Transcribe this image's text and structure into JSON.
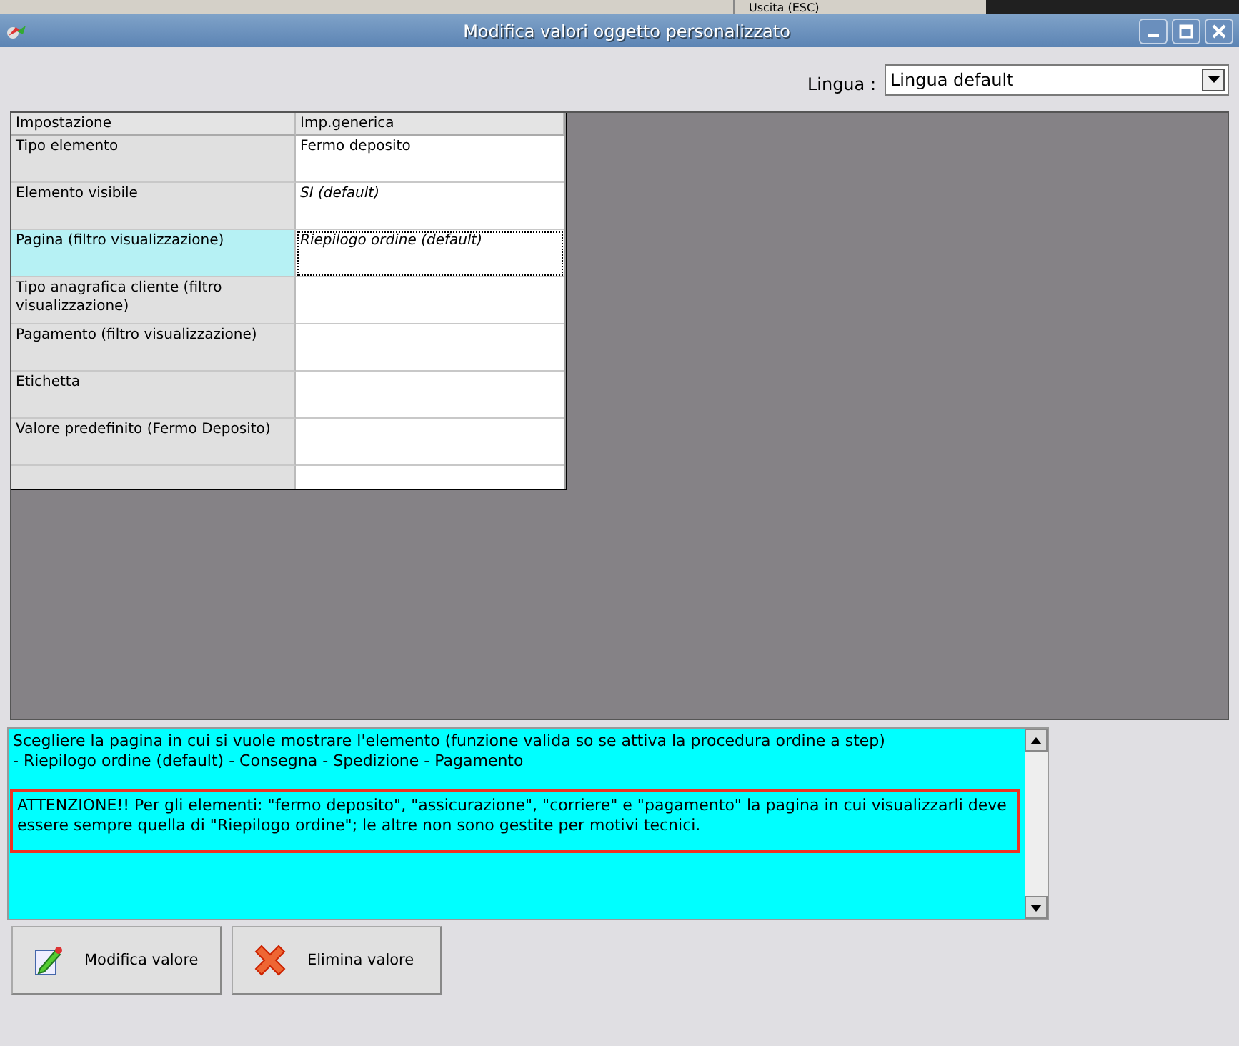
{
  "background_window": {
    "menu_item": "Uscita (ESC)"
  },
  "window": {
    "title": "Modifica valori oggetto personalizzato"
  },
  "language": {
    "label": "Lingua :",
    "value": "Lingua default"
  },
  "table": {
    "columns": [
      "Impostazione",
      "Imp.generica"
    ],
    "rows": [
      {
        "label": "Tipo elemento",
        "value": "Fermo deposito",
        "is_default": false,
        "selected": false
      },
      {
        "label": "Elemento visibile",
        "value": "SI (default)",
        "is_default": true,
        "selected": false
      },
      {
        "label": "Pagina (filtro visualizzazione)",
        "value": "Riepilogo ordine (default)",
        "is_default": true,
        "selected": true
      },
      {
        "label": "Tipo anagrafica cliente (filtro visualizzazione)",
        "selected": false
      },
      {
        "label": "Pagamento (filtro visualizzazione)",
        "selected": false
      },
      {
        "label": "Etichetta",
        "selected": false
      },
      {
        "label": "Valore predefinito (Fermo Deposito)",
        "selected": false
      }
    ]
  },
  "help": {
    "lines": [
      "Scegliere la pagina in cui si vuole mostrare l'elemento (funzione valida so se attiva la procedura ordine a step)",
      "- Riepilogo ordine (default) - Consegna - Spedizione - Pagamento"
    ],
    "warning": "ATTENZIONE!! Per gli elementi: \"fermo deposito\", \"assicurazione\", \"corriere\" e \"pagamento\" la pagina in cui visualizzarli deve essere sempre quella di \"Riepilogo ordine\"; le altre non sono gestite per motivi tecnici."
  },
  "buttons": [
    {
      "label": "Modifica valore",
      "kind": "edit"
    },
    {
      "label": "Elimina valore",
      "kind": "delete"
    }
  ]
}
